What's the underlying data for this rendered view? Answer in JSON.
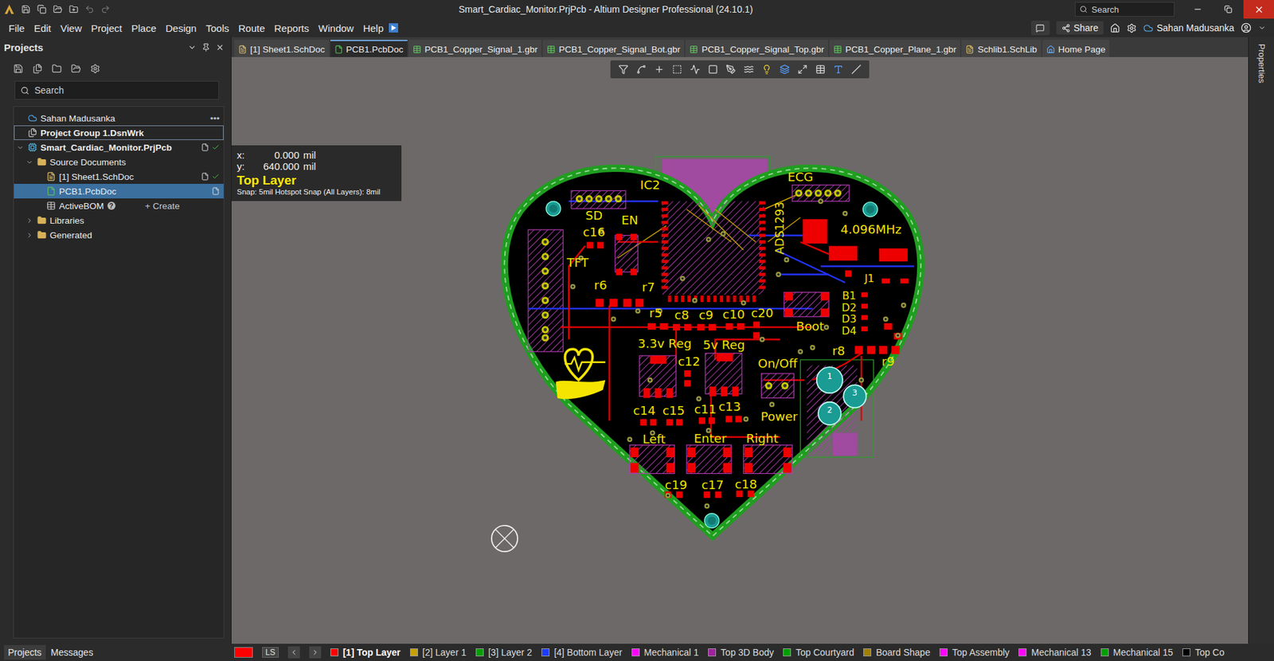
{
  "window": {
    "title": "Smart_Cardiac_Monitor.PrjPcb - Altium Designer Professional (24.10.1)",
    "search": "Search"
  },
  "menu": [
    "File",
    "Edit",
    "View",
    "Project",
    "Place",
    "Design",
    "Tools",
    "Route",
    "Reports",
    "Window",
    "Help"
  ],
  "account_bar": {
    "share": "Share",
    "user": "Sahan Madusanka"
  },
  "projects_panel": {
    "title": "Projects",
    "search": "Search",
    "tree": [
      {
        "label": "Sahan Madusanka",
        "level": 0,
        "kind": "account",
        "expandable": false,
        "expanded": false,
        "selected": false,
        "focused": false,
        "status": "none",
        "more": "•••"
      },
      {
        "label": "Project Group 1.DsnWrk",
        "level": 0,
        "kind": "workspace",
        "expandable": false,
        "expanded": false,
        "selected": false,
        "focused": true,
        "status": "none"
      },
      {
        "label": "Smart_Cardiac_Monitor.PrjPcb",
        "level": 0,
        "kind": "project",
        "expandable": true,
        "expanded": true,
        "selected": false,
        "focused": false,
        "status": "saved"
      },
      {
        "label": "Source Documents",
        "level": 1,
        "kind": "folder",
        "expandable": true,
        "expanded": true,
        "selected": false,
        "focused": false,
        "status": "none"
      },
      {
        "label": "[1] Sheet1.SchDoc",
        "level": 2,
        "kind": "sch",
        "expandable": false,
        "expanded": false,
        "selected": false,
        "focused": false,
        "status": "saved"
      },
      {
        "label": "PCB1.PcbDoc",
        "level": 2,
        "kind": "pcb",
        "expandable": false,
        "expanded": false,
        "selected": true,
        "focused": false,
        "status": "open"
      },
      {
        "label": "ActiveBOM",
        "level": 2,
        "kind": "bom",
        "expandable": false,
        "expanded": false,
        "selected": false,
        "focused": false,
        "status": "none",
        "help": "?",
        "action": "+ Create"
      },
      {
        "label": "Libraries",
        "level": 1,
        "kind": "folder",
        "expandable": true,
        "expanded": false,
        "selected": false,
        "focused": false,
        "status": "none"
      },
      {
        "label": "Generated",
        "level": 1,
        "kind": "folder",
        "expandable": true,
        "expanded": false,
        "selected": false,
        "focused": false,
        "status": "none"
      }
    ],
    "tabs": [
      {
        "label": "Projects",
        "selected": true
      },
      {
        "label": "Messages",
        "selected": false
      }
    ]
  },
  "doc_tabs": [
    {
      "label": "[1] Sheet1.SchDoc",
      "kind": "sch",
      "selected": false
    },
    {
      "label": "PCB1.PcbDoc",
      "kind": "pcb",
      "selected": true
    },
    {
      "label": "PCB1_Copper_Signal_1.gbr",
      "kind": "gbr",
      "selected": false
    },
    {
      "label": "PCB1_Copper_Signal_Bot.gbr",
      "kind": "gbr",
      "selected": false
    },
    {
      "label": "PCB1_Copper_Signal_Top.gbr",
      "kind": "gbr",
      "selected": false
    },
    {
      "label": "PCB1_Copper_Plane_1.gbr",
      "kind": "gbr",
      "selected": false
    },
    {
      "label": "Schlib1.SchLib",
      "kind": "schlib",
      "selected": false
    },
    {
      "label": "Home Page",
      "kind": "home",
      "selected": false
    }
  ],
  "hud": {
    "x_label": "x:",
    "x": "0.000",
    "x_unit": "mil",
    "y_label": "y:",
    "y": "640.000",
    "y_unit": "mil",
    "layer": "Top Layer",
    "snap": "Snap: 5mil Hotspot Snap (All Layers): 8mil"
  },
  "pcb": {
    "labels": [
      "IC2",
      "SD",
      "EN",
      "c16",
      "TFT",
      "r6",
      "r7",
      "r5",
      "c8",
      "c9",
      "c10",
      "c20",
      "Boot",
      "3.3v Reg",
      "5v Reg",
      "c12",
      "On/Off",
      "r8",
      "r9",
      "ECG",
      "ADS1293",
      "4.096MHz",
      "B1",
      "D2",
      "D3",
      "D4",
      "J1",
      "c14",
      "c15",
      "c11",
      "c13",
      "Power",
      "Left",
      "Enter",
      "Right",
      "c19",
      "c17",
      "c18"
    ],
    "battery_pads": [
      "1",
      "2",
      "3"
    ]
  },
  "properties": "Properties",
  "layers": {
    "active_color": "#ff0000",
    "ls": "LS",
    "items": [
      {
        "label": "[1] Top Layer",
        "color": "#ff0000",
        "selected": true
      },
      {
        "label": "[2] Layer 1",
        "color": "#c8a000",
        "selected": false
      },
      {
        "label": "[3] Layer 2",
        "color": "#00a000",
        "selected": false
      },
      {
        "label": "[4] Bottom Layer",
        "color": "#1e3cff",
        "selected": false
      },
      {
        "label": "Mechanical 1",
        "color": "#ff00ff",
        "selected": false
      },
      {
        "label": "Top 3D Body",
        "color": "#a020a0",
        "selected": false
      },
      {
        "label": "Top Courtyard",
        "color": "#00a000",
        "selected": false
      },
      {
        "label": "Board Shape",
        "color": "#a08000",
        "selected": false
      },
      {
        "label": "Top Assembly",
        "color": "#ff00ff",
        "selected": false
      },
      {
        "label": "Mechanical 13",
        "color": "#ff00ff",
        "selected": false
      },
      {
        "label": "Mechanical 15",
        "color": "#00a000",
        "selected": false
      },
      {
        "label": "Top Co",
        "color": "#000000",
        "selected": false
      }
    ]
  }
}
